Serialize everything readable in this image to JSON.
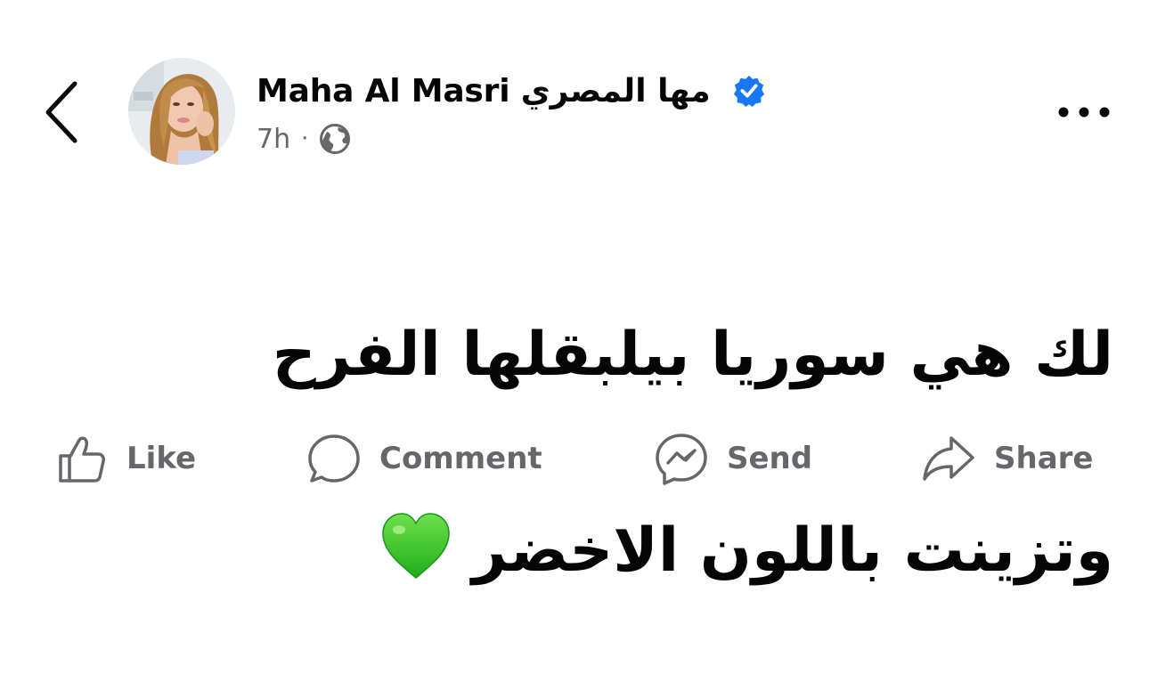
{
  "header": {
    "author_name": "Maha Al Masri مها  المصري",
    "verified": true,
    "timestamp": "7h",
    "separator": "·",
    "audience_icon": "globe-icon"
  },
  "post": {
    "line1": "لك هي سوريا بيلبقلها الفرح",
    "line2": "وتزينت باللون الاخضر",
    "emoji": "green-heart"
  },
  "actions": {
    "like": "Like",
    "comment": "Comment",
    "send": "Send",
    "share": "Share"
  },
  "colors": {
    "text_primary": "#050505",
    "text_secondary": "#65676b",
    "verified_blue": "#1877f2",
    "heart_green": "#3ecf2e"
  }
}
